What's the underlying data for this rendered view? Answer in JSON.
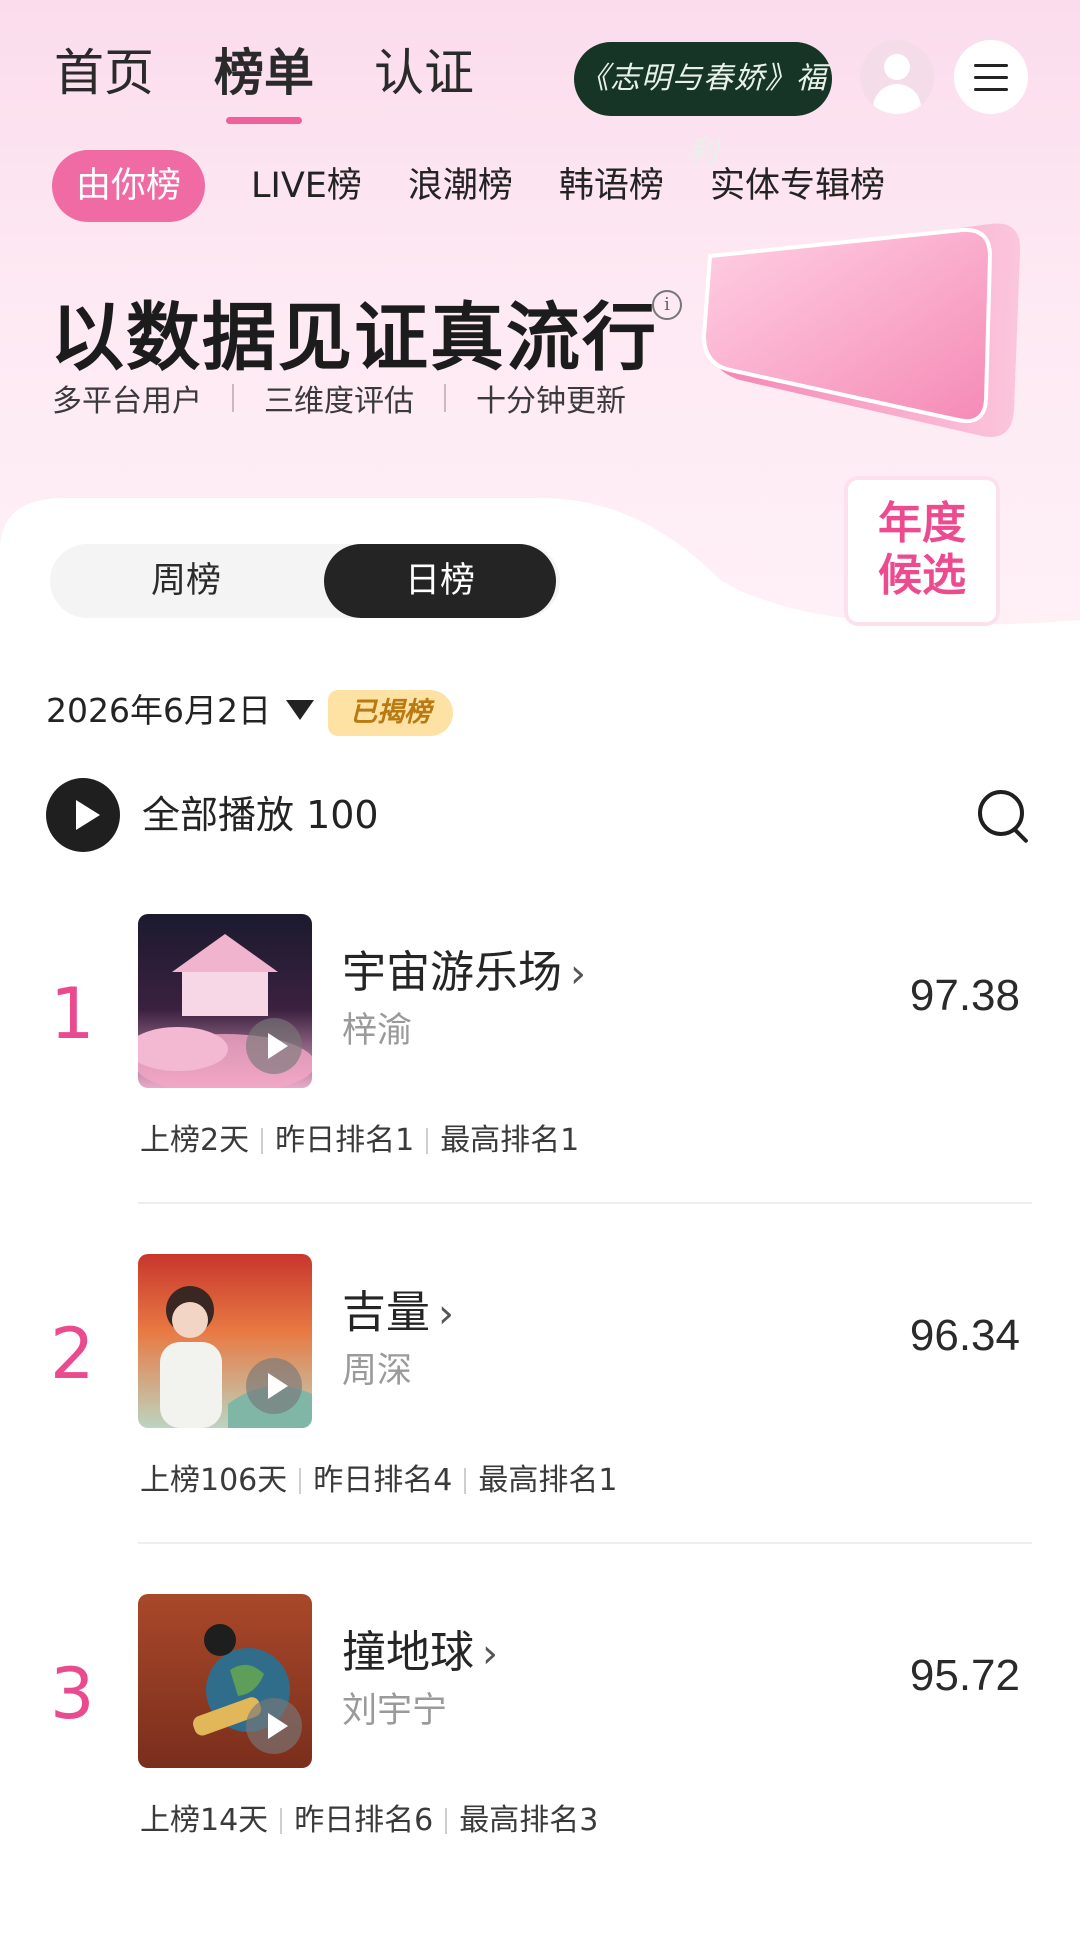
{
  "nav": {
    "items": [
      "首页",
      "榜单",
      "认证"
    ],
    "active": "榜单"
  },
  "promo": {
    "label": "《志明与春娇》福利"
  },
  "subtabs": [
    "由你榜",
    "LIVE榜",
    "浪潮榜",
    "韩语榜",
    "实体专辑榜"
  ],
  "hero": {
    "headline": "以数据见证真流行",
    "info_icon": "info-icon",
    "features": [
      "多平台用户",
      "三维度评估",
      "十分钟更新"
    ],
    "badge_line1": "年度",
    "badge_line2": "候选"
  },
  "period_tabs": {
    "weekly": "周榜",
    "daily": "日榜",
    "active": "日榜"
  },
  "date": "2026年6月2日",
  "status_badge": "已揭榜",
  "play_all": "全部播放 100",
  "songs": [
    {
      "rank": "1",
      "title": "宇宙游乐场",
      "artist": "梓渝",
      "score": "97.38",
      "days": "上榜2天",
      "yesterday": "昨日排名1",
      "best": "最高排名1"
    },
    {
      "rank": "2",
      "title": "吉量",
      "artist": "周深",
      "score": "96.34",
      "days": "上榜106天",
      "yesterday": "昨日排名4",
      "best": "最高排名1"
    },
    {
      "rank": "3",
      "title": "撞地球",
      "artist": "刘宇宁",
      "score": "95.72",
      "days": "上榜14天",
      "yesterday": "昨日排名6",
      "best": "最高排名3"
    }
  ],
  "colors": {
    "accent": "#ea4a8e",
    "pill": "#f06aa4",
    "dark": "#242424"
  }
}
